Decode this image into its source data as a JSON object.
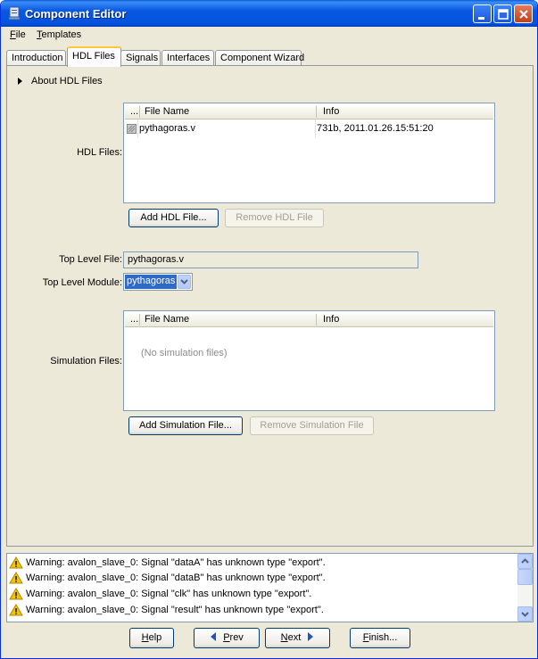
{
  "window": {
    "title": "Component Editor"
  },
  "menu": {
    "file_u": "F",
    "file_rest": "ile",
    "templates_u": "T",
    "templates_rest": "emplates"
  },
  "tabs": [
    {
      "label": "Introduction"
    },
    {
      "label": "HDL Files"
    },
    {
      "label": "Signals"
    },
    {
      "label": "Interfaces"
    },
    {
      "label": "Component Wizard"
    }
  ],
  "about": {
    "label": "About HDL Files"
  },
  "hdl": {
    "label": "HDL Files:",
    "columns": {
      "ellipsis": "...",
      "name": "File Name",
      "info": "Info"
    },
    "rows": [
      {
        "file": "pythagoras.v",
        "info": "731b, 2011.01.26.15:51:20"
      }
    ],
    "add_button": "Add HDL File...",
    "remove_button": "Remove HDL File"
  },
  "top_level_file": {
    "label": "Top Level File:",
    "value": "pythagoras.v"
  },
  "top_level_module": {
    "label": "Top Level Module:",
    "value": "pythagoras"
  },
  "simulation": {
    "label": "Simulation Files:",
    "columns": {
      "ellipsis": "...",
      "name": "File Name",
      "info": "Info"
    },
    "empty_text": "(No simulation files)",
    "add_button": "Add Simulation File...",
    "remove_button": "Remove Simulation File"
  },
  "log": [
    "Warning: avalon_slave_0: Signal \"dataA\" has unknown type \"export\".",
    "Warning: avalon_slave_0: Signal \"dataB\" has unknown type \"export\".",
    "Warning: avalon_slave_0: Signal \"clk\" has unknown type \"export\".",
    "Warning: avalon_slave_0: Signal \"result\" has unknown type \"export\"."
  ],
  "footer": {
    "help_u": "H",
    "help_rest": "elp",
    "prev_u": "P",
    "prev_rest": "rev",
    "next_u": "N",
    "next_rest": "ext",
    "finish_u": "F",
    "finish_rest": "inish..."
  },
  "colors": {
    "titlebar": "#0858e3",
    "selection": "#316ac5",
    "warning": "#f5c400"
  }
}
